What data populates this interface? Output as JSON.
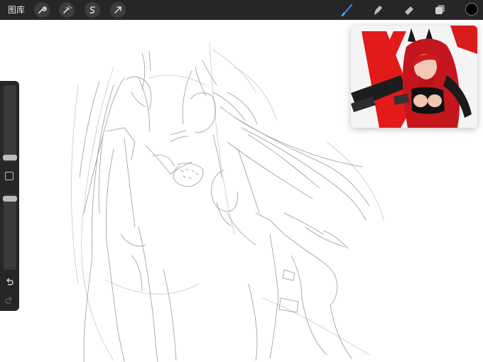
{
  "topbar": {
    "gallery_label": "图库",
    "left_tools": [
      "wrench-icon",
      "magic-wand-icon",
      "selection-icon",
      "transform-arrow-icon"
    ],
    "right_tools": [
      "brush-icon",
      "smudge-icon",
      "eraser-icon",
      "layers-icon"
    ],
    "active_tool": "brush-icon",
    "active_tool_color": "#2f7bf5",
    "current_color": "#000000"
  },
  "sidebar": {
    "items": [
      "brush-size-slider",
      "modify-button",
      "opacity-slider",
      "undo-icon",
      "redo-icon"
    ]
  },
  "reference_window": {
    "content": "reference-image"
  }
}
